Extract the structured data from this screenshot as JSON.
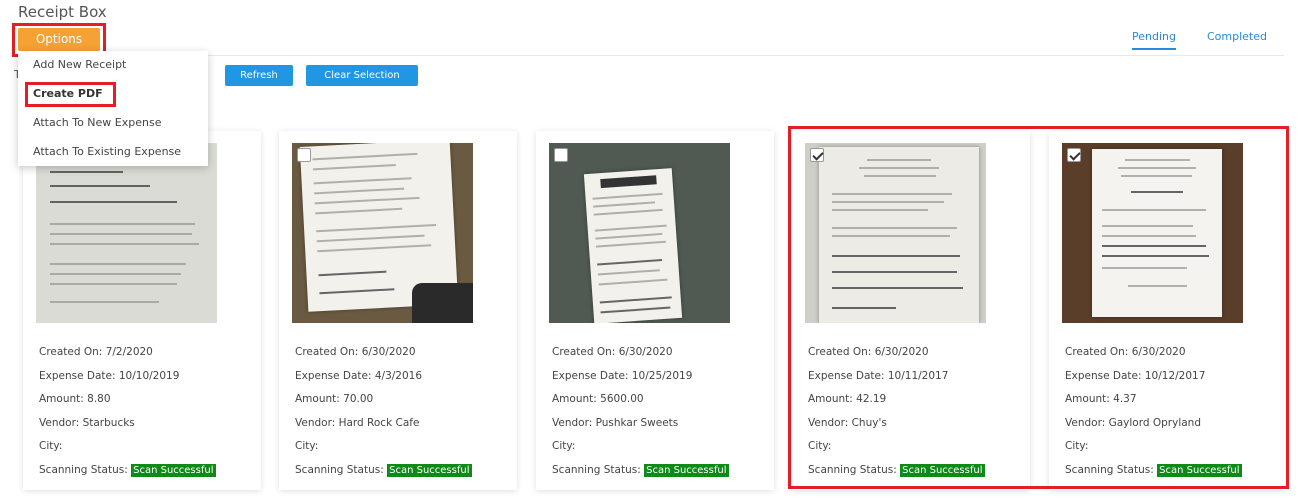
{
  "header": {
    "title": "Receipt Box",
    "options_label": "Options"
  },
  "tabs": [
    {
      "label": "Pending"
    },
    {
      "label": "Completed"
    }
  ],
  "toolbar": {
    "partial_text": "T",
    "refresh_label": "Refresh",
    "clear_label": "Clear Selection"
  },
  "options_menu": {
    "items": [
      {
        "label": "Add New Receipt"
      },
      {
        "label": "Create PDF"
      },
      {
        "label": "Attach To New Expense"
      },
      {
        "label": "Attach To Existing Expense"
      }
    ]
  },
  "labels": {
    "created_on": "Created On:",
    "expense_date": "Expense Date:",
    "amount": "Amount:",
    "vendor": "Vendor:",
    "city": "City:",
    "scanning_status": "Scanning Status:"
  },
  "colors": {
    "options_button": "#f5a133",
    "action_button": "#2196e3",
    "tab_active": "#2b8ad8",
    "status_badge": "#0e8a16",
    "highlight": "#e31e24"
  },
  "receipts": [
    {
      "created_on": "7/2/2020",
      "expense_date": "10/10/2019",
      "amount": "8.80",
      "vendor": "Starbucks",
      "city": "",
      "status": "Scan Successful",
      "checked": false
    },
    {
      "created_on": "6/30/2020",
      "expense_date": "4/3/2016",
      "amount": "70.00",
      "vendor": "Hard Rock Cafe",
      "city": "",
      "status": "Scan Successful",
      "checked": false
    },
    {
      "created_on": "6/30/2020",
      "expense_date": "10/25/2019",
      "amount": "5600.00",
      "vendor": "Pushkar Sweets",
      "city": "",
      "status": "Scan Successful",
      "checked": false
    },
    {
      "created_on": "6/30/2020",
      "expense_date": "10/11/2017",
      "amount": "42.19",
      "vendor": "Chuy's",
      "city": "",
      "status": "Scan Successful",
      "checked": true
    },
    {
      "created_on": "6/30/2020",
      "expense_date": "10/12/2017",
      "amount": "4.37",
      "vendor": "Gaylord Opryland",
      "city": "",
      "status": "Scan Successful",
      "checked": true
    }
  ]
}
